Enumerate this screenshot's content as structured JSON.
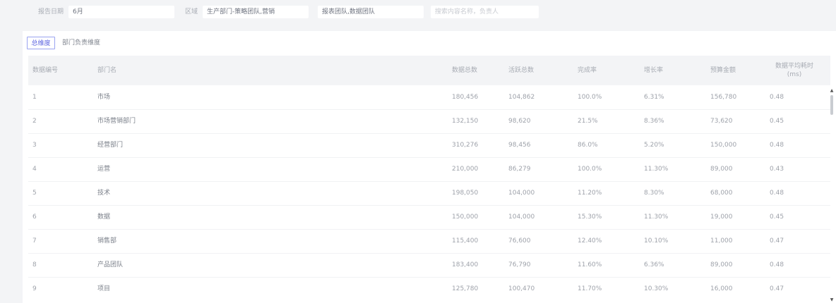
{
  "filters": {
    "field1_label": "报告日期",
    "field1_value": "6月",
    "field2_label": "区域",
    "field2_value": "生产部门-策略团队,营销",
    "field3_value": "报表团队,数据团队",
    "field4_placeholder": "搜索内容名称，负责人"
  },
  "tabs": [
    {
      "label": "总维度"
    },
    {
      "label": "部门负责维度"
    }
  ],
  "table": {
    "headers": [
      "数据编号",
      "部门名",
      "数据总数",
      "活跃总数",
      "完成率",
      "增长率",
      "预算金额",
      "数据平均耗时(ms)"
    ],
    "rows": [
      [
        "1",
        "市场",
        "180,456",
        "104,862",
        "100.0%",
        "6.31%",
        "156,780",
        "0.48"
      ],
      [
        "2",
        "市场营销部门",
        "132,150",
        "98,620",
        "21.5%",
        "8.36%",
        "73,620",
        "0.45"
      ],
      [
        "3",
        "经营部门",
        "310,276",
        "98,456",
        "86.0%",
        "5.20%",
        "150,000",
        "0.48"
      ],
      [
        "4",
        "运营",
        "210,000",
        "86,279",
        "100.0%",
        "11.30%",
        "89,000",
        "0.43"
      ],
      [
        "5",
        "技术",
        "198,050",
        "104,000",
        "11.20%",
        "8.30%",
        "68,000",
        "0.48"
      ],
      [
        "6",
        "数据",
        "150,000",
        "104,000",
        "15.30%",
        "11.30%",
        "19,000",
        "0.45"
      ],
      [
        "7",
        "销售部",
        "115,400",
        "76,600",
        "12.40%",
        "10.10%",
        "11,000",
        "0.47"
      ],
      [
        "8",
        "产品团队",
        "183,400",
        "76,790",
        "11.60%",
        "6.36%",
        "89,000",
        "0.48"
      ],
      [
        "9",
        "项目",
        "125,780",
        "100,470",
        "11.70%",
        "10.30%",
        "16,000",
        "0.47"
      ]
    ]
  }
}
